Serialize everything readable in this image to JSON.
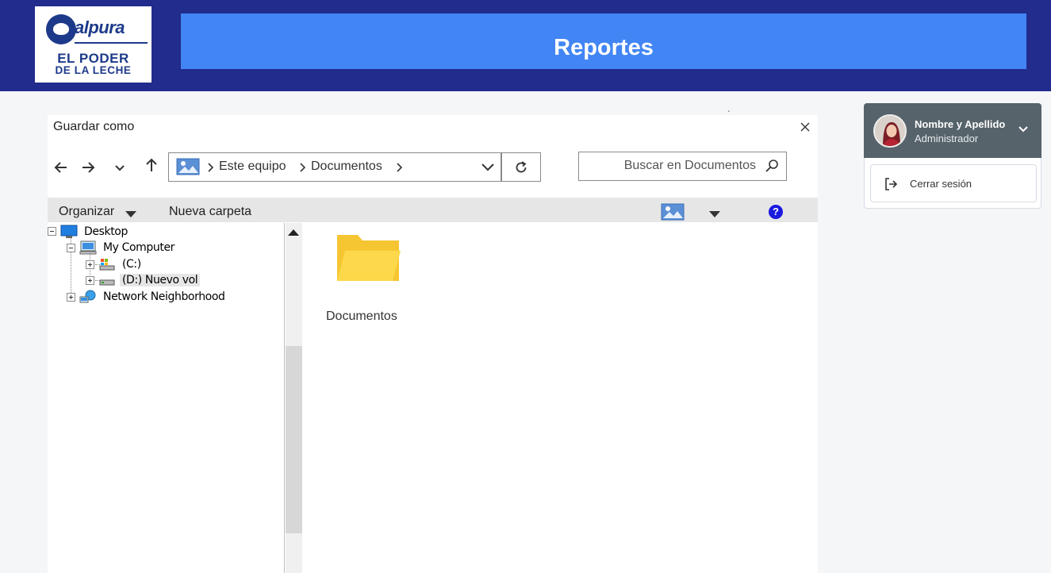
{
  "header": {
    "brand": "alpura",
    "tagline_line1": "EL PODER",
    "tagline_line2": "DE LA LECHE",
    "title": "Reportes"
  },
  "dialog": {
    "title": "Guardar como",
    "breadcrumb": [
      "Este equipo",
      "Documentos"
    ],
    "search_placeholder": "Buscar en Documentos",
    "toolbar": {
      "organize": "Organizar",
      "new_folder": "Nueva carpeta",
      "help": "?"
    },
    "tree": [
      {
        "label": "Desktop",
        "icon": "desktop-icon"
      },
      {
        "label": "My Computer",
        "icon": "computer-icon"
      },
      {
        "label": "(C:)",
        "icon": "drive-c-icon"
      },
      {
        "label": "(D:) Nuevo vol",
        "icon": "drive-d-icon"
      },
      {
        "label": "Network Neighborhood",
        "icon": "network-icon"
      }
    ],
    "files": [
      {
        "name": "Documentos",
        "icon": "folder-icon"
      }
    ]
  },
  "user": {
    "name": "Nombre y Apellido",
    "role": "Administrador",
    "logout_label": "Cerrar sesión"
  },
  "colors": {
    "header_bg": "#222c8c",
    "banner_bg": "#4285f4",
    "folder": "#fdd84a",
    "user_panel_bg": "#56636a"
  }
}
